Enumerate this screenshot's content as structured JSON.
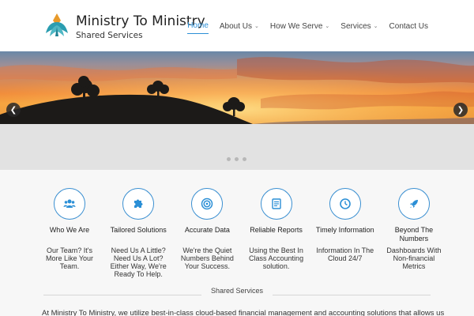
{
  "brand": {
    "title": "Ministry To Ministry",
    "subtitle": "Shared Services",
    "logo_icon": "lotus-logo-icon"
  },
  "nav": {
    "items": [
      {
        "label": "Home",
        "active": true,
        "dropdown": false
      },
      {
        "label": "About Us",
        "active": false,
        "dropdown": true
      },
      {
        "label": "How We Serve",
        "active": false,
        "dropdown": true
      },
      {
        "label": "Services",
        "active": false,
        "dropdown": true
      },
      {
        "label": "Contact Us",
        "active": false,
        "dropdown": false
      }
    ]
  },
  "slider": {
    "prev_icon": "chevron-left-icon",
    "next_icon": "chevron-right-icon",
    "dots": 3
  },
  "features": [
    {
      "icon": "people-icon",
      "title": "Who We Are",
      "desc": "Our Team? It's More Like Your Team."
    },
    {
      "icon": "puzzle-icon",
      "title": "Tailored Solutions",
      "desc": "Need Us A Little? Need Us A Lot? Either Way, We're Ready To Help."
    },
    {
      "icon": "target-icon",
      "title": "Accurate Data",
      "desc": "We're the Quiet Numbers Behind Your Success."
    },
    {
      "icon": "report-icon",
      "title": "Reliable Reports",
      "desc": "Using the Best In Class Accounting solution."
    },
    {
      "icon": "clock-icon",
      "title": "Timely Information",
      "desc": "Information In The Cloud 24/7"
    },
    {
      "icon": "rocket-icon",
      "title": "Beyond The Numbers",
      "desc": "Dashboards With Non-financial Metrics"
    }
  ],
  "section": {
    "title": "Shared Services",
    "intro": "At Ministry To Ministry, we utilize best-in-class cloud-based financial management and accounting solutions that allows us"
  },
  "colors": {
    "accent": "#2b8fd6",
    "icon_border": "#3a8fd1"
  }
}
